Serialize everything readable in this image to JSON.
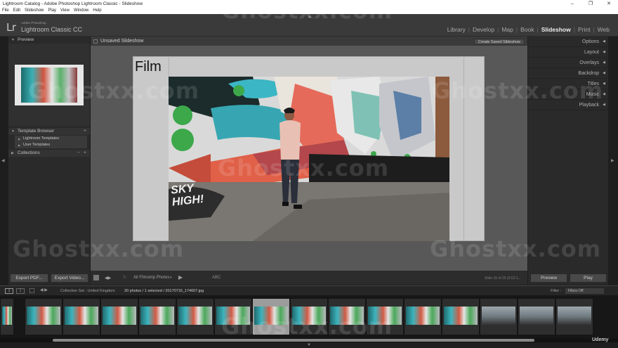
{
  "window": {
    "title": "Lightroom Catalog - Adobe Photoshop Lightroom Classic - Slideshow",
    "controls": [
      "–",
      "❐",
      "✕"
    ]
  },
  "menu": [
    "File",
    "Edit",
    "Slideshow",
    "Play",
    "View",
    "Window",
    "Help"
  ],
  "brand": {
    "logo": "Lr",
    "sub1": "Adobe Photoshop",
    "sub2": "Lightroom Classic CC"
  },
  "modules": [
    "Library",
    "Develop",
    "Map",
    "Book",
    "Slideshow",
    "Print",
    "Web"
  ],
  "active_module": "Slideshow",
  "left_panel": {
    "preview_label": "Preview",
    "template_browser_label": "Template Browser",
    "templates": [
      "Lightroom Templates",
      "User Templates"
    ],
    "collections_label": "Collections",
    "export_pdf": "Export PDF...",
    "export_video": "Export Video..."
  },
  "center": {
    "slideshow_name": "Unsaved Slideshow",
    "create_button": "Create Saved Slideshow",
    "slide_title": "Film",
    "graffiti_text": "SKY HIGH!",
    "toolbar": {
      "source": "All Filmstrip Photos",
      "abc": "ABC",
      "counter": "Slide 16 of 20 (0:02:1..."
    }
  },
  "right_panel": {
    "sections": [
      "Options",
      "Layout",
      "Overlays",
      "Backdrop",
      "Titles",
      "Music",
      "Playback"
    ],
    "preview_button": "Preview",
    "play_button": "Play"
  },
  "filmstrip": {
    "page_1": "1",
    "page_2": "2",
    "source": "Collection Set : United Kingdom",
    "count": "20 photos / 1 selected / 20170716_174607.jpg",
    "filter_label": "Filter :",
    "filter_value": "Filters Off",
    "selected_index": 7,
    "thumb_count": 16
  },
  "watermarks": [
    "Ghostxx.com"
  ],
  "udemy": "Udemy",
  "colors": {
    "panel_bg": "#2a2a2a",
    "center_bg": "#585858",
    "active_text": "#ececec"
  }
}
